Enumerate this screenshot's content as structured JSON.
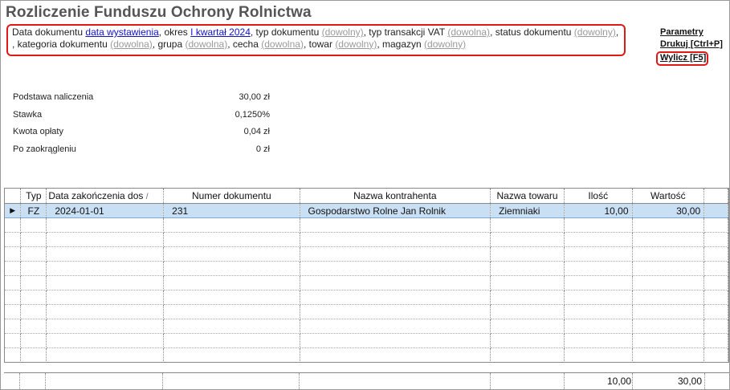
{
  "title": "Rozliczenie Funduszu Ochrony Rolnictwa",
  "filters": {
    "data_dokumentu_label": "Data dokumentu",
    "data_dokumentu_value": "data wystawienia",
    "okres_label": ", okres",
    "okres_value": "I kwartał 2024",
    "typ_dokumentu_label": ", typ dokumentu",
    "typ_dokumentu_value": "(dowolny)",
    "typ_transakcji_label": ", typ transakcji VAT",
    "typ_transakcji_value": "(dowolna)",
    "status_label": ", status dokumentu",
    "status_value": "(dowolny)",
    "kategoria_label": ", kategoria dokumentu",
    "kategoria_value": "(dowolna)",
    "grupa_label": ", grupa",
    "grupa_value": "(dowolna)",
    "cecha_label": ", cecha",
    "cecha_value": "(dowolna)",
    "towar_label": ", towar",
    "towar_value": "(dowolny)",
    "magazyn_label": ", magazyn",
    "magazyn_value": "(dowolny)",
    "trailing_comma": ","
  },
  "actions": {
    "parametry": "Parametry",
    "drukuj": "Drukuj [Ctrl+P]",
    "wylicz": "Wylicz [F5]"
  },
  "summary": [
    {
      "label": "Podstawa naliczenia",
      "value": "30,00 zł"
    },
    {
      "label": "Stawka",
      "value": "0,1250%"
    },
    {
      "label": "Kwota opłaty",
      "value": "0,04 zł"
    },
    {
      "label": "Po zaokrągleniu",
      "value": "0 zł"
    }
  ],
  "table": {
    "columns": [
      "Typ",
      "Data zakończenia dos",
      "Numer dokumentu",
      "Nazwa kontrahenta",
      "Nazwa towaru",
      "Ilość",
      "Wartość"
    ],
    "rows": [
      {
        "typ": "FZ",
        "data": "2024-01-01",
        "numer": "231",
        "kontrahent": "Gospodarstwo Rolne Jan Rolnik",
        "towar": "Ziemniaki",
        "ilosc": "10,00",
        "wartosc": "30,00"
      }
    ],
    "row_indicator": "▶",
    "sort_indicator": "/"
  },
  "totals": {
    "ilosc": "10,00",
    "wartosc": "30,00"
  },
  "colors": {
    "highlight_border": "#e01818",
    "link_blue": "#1212c8",
    "link_gray": "#9a9a9a",
    "selected_row": "#c9e0f4"
  }
}
